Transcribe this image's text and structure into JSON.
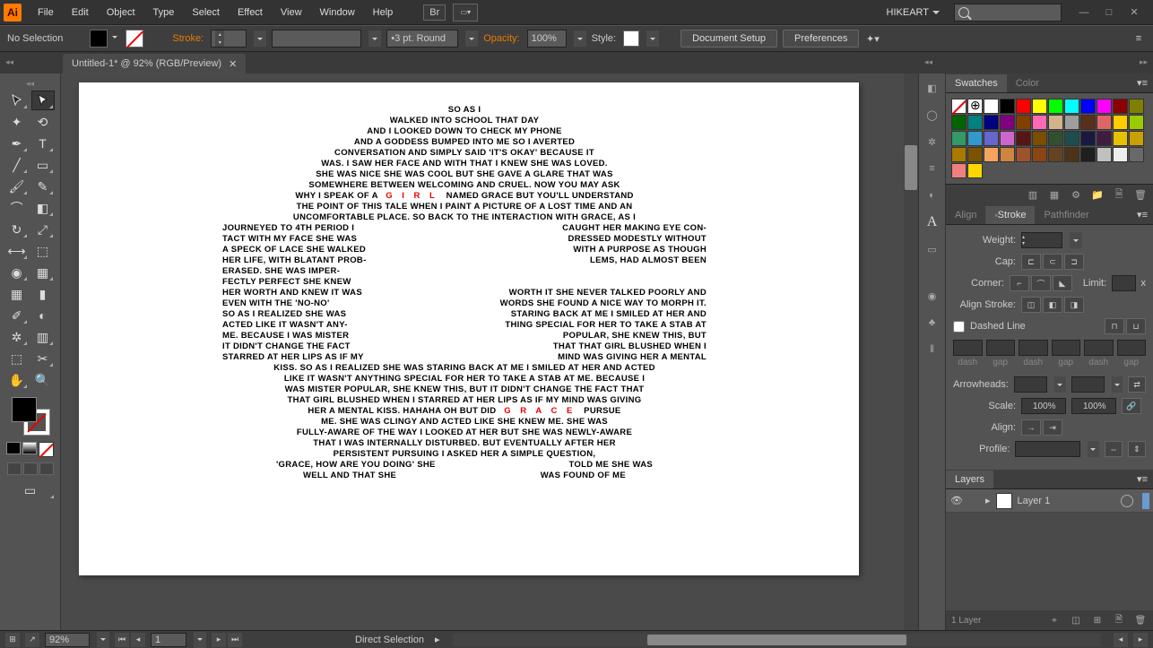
{
  "menubar": {
    "items": [
      "File",
      "Edit",
      "Object",
      "Type",
      "Select",
      "Effect",
      "View",
      "Window",
      "Help"
    ],
    "br": "Br",
    "user": "HIKEART"
  },
  "controlbar": {
    "selection": "No Selection",
    "stroke_label": "Stroke:",
    "brush_label": "3 pt. Round",
    "opacity_label": "Opacity:",
    "opacity_value": "100%",
    "style_label": "Style:",
    "doc_setup": "Document Setup",
    "prefs": "Preferences"
  },
  "tab": {
    "title": "Untitled-1* @ 92% (RGB/Preview)"
  },
  "panels": {
    "swatches_tabs": [
      "Swatches",
      "Color"
    ],
    "stroke_tabs": [
      "Align",
      "Stroke",
      "Pathfinder"
    ],
    "stroke": {
      "weight": "Weight:",
      "cap": "Cap:",
      "corner": "Corner:",
      "limit": "Limit:",
      "limit_x": "x",
      "align_stroke": "Align Stroke:",
      "dashed": "Dashed Line",
      "dash": "dash",
      "gap": "gap",
      "arrowheads": "Arrowheads:",
      "scale": "Scale:",
      "scale_val": "100%",
      "align": "Align:",
      "profile": "Profile:"
    },
    "layers_tab": "Layers",
    "layer1": "Layer 1",
    "layers_count": "1 Layer"
  },
  "statusbar": {
    "zoom": "92%",
    "page": "1",
    "tool": "Direct Selection"
  },
  "swatch_colors": [
    "none",
    "reg",
    "#ffffff",
    "#000000",
    "#ff0000",
    "#ffff00",
    "#00ff00",
    "#00ffff",
    "#0000ff",
    "#ff00ff",
    "#8b0000",
    "#808000",
    "#006400",
    "#008080",
    "#000080",
    "#800080",
    "#804000",
    "#ff69b4",
    "#d2b48c",
    "#9e9e9e",
    "#59311b",
    "#e06666",
    "#ffcc00",
    "#99cc00",
    "#339966",
    "#3399cc",
    "#6666cc",
    "#cc66cc",
    "#571616",
    "#7a4d00",
    "#305030",
    "#1d4d4d",
    "#1a1a40",
    "#3f1d3f",
    "#e6c100",
    "#c8a000",
    "#a87a00",
    "#7a5200",
    "#f4a460",
    "#cd853f",
    "#a0522d",
    "#8b4513",
    "#654321",
    "#4d3319",
    "#1f1f1f",
    "#c0c0c0",
    "#eeeeee",
    "#696969",
    "#f08080",
    "#ffd700"
  ],
  "artboard_text": {
    "top": [
      "so as i",
      "walked into school that day",
      "and i looked down to check my phone",
      "and a goddess bumped into me so i averted",
      "conversation and simply said 'it's okay' because it",
      "was. i saw her face and with that i knew she was loved.",
      "she was nice she was cool but she gave a glare that was",
      "somewhere between welcoming and cruel. now you may ask"
    ],
    "girl_line": {
      "left": "why i speak of a",
      "mid": "G I R L",
      "right": "named Grace but you'll understand"
    },
    "mid1": [
      "the point of this tale when i paint a picture of a lost time and an",
      "uncomfortable place. so back to the interaction with Grace, as i"
    ],
    "split": [
      {
        "l": "journeyed to 4th period i",
        "r": "caught her making eye con-"
      },
      {
        "l": "tact with my face she was",
        "r": "dressed modestly without"
      },
      {
        "l": "a speck of lace she walked",
        "r": "with a purpose as though"
      },
      {
        "l": "her life, with blatant prob-",
        "r": "lems,  had  almost  been"
      },
      {
        "l": "erased.  she  was  imper-",
        "r": ""
      },
      {
        "l": "fectly perfect she knew",
        "r": ""
      },
      {
        "l": "her worth and knew it was",
        "r": "worth it she never talked poorly and"
      },
      {
        "l": "even   with   the   'no-no'",
        "r": "words she found a nice way to morph it."
      },
      {
        "l": "so as i realized she was",
        "r": "staring back at me i smiled at her and"
      },
      {
        "l": "acted like it wasn't any-",
        "r": "thing special for her to take a stab at"
      },
      {
        "l": "me.  because  i was mister",
        "r": "popular, she knew this, but"
      },
      {
        "l": "it didn't change the fact",
        "r": "that that girl blushed when i"
      },
      {
        "l": "starred at her lips as if my",
        "r": "mind was giving her a mental"
      }
    ],
    "bottom": [
      "kiss. so as i realized she was staring back at me i smiled at her and acted",
      "like it wasn't anything special for her to take a stab at me. because i",
      "was mister popular, she knew this, but it didn't change the fact that",
      "that girl blushed when i starred at her lips as if my mind was giving"
    ],
    "grace_line": {
      "left": "her a mental kiss. hahaha oh but did",
      "mid": "G r a c e",
      "right": "pursue"
    },
    "bottom2": [
      "me. she was clingy and acted like she knew me. she was",
      "fully-aware of the way i looked at her but she was newly-aware",
      "that i was internally disturbed. but eventually after her",
      "persistent pursuing i asked her a simple question,"
    ],
    "last_split": {
      "l": "'grace, how are you doing' she",
      "r": "told me she was"
    },
    "last": {
      "l": "well and that she",
      "r": "was found of me"
    }
  }
}
